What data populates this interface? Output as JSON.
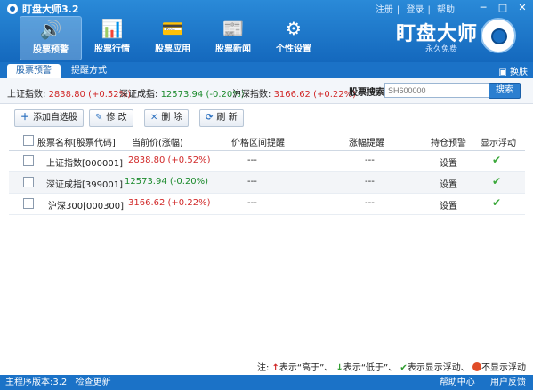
{
  "app": {
    "title": "盯盘大师3.2",
    "brand": "盯盘大师",
    "brand_sub": "永久免费"
  },
  "top_links": [
    "注册",
    "登录",
    "帮助"
  ],
  "window_controls": [
    "─",
    "□",
    "✕"
  ],
  "nav": [
    {
      "label": "股票预警",
      "icon": "🔊"
    },
    {
      "label": "股票行情",
      "icon": "📊"
    },
    {
      "label": "股票应用",
      "icon": "💳"
    },
    {
      "label": "股票新闻",
      "icon": "📰"
    },
    {
      "label": "个性设置",
      "icon": "⚙"
    }
  ],
  "tabs": {
    "tab1": "股票预警",
    "tab2": "提醒方式"
  },
  "skin": "换肤",
  "indices": [
    {
      "label": "上证指数:",
      "value": "2838.80 (+0.52%)"
    },
    {
      "label": "深证成指:",
      "value": "12573.94 (-0.20%)"
    },
    {
      "label": "沪深指数:",
      "value": "3166.62 (+0.22%)"
    }
  ],
  "search": {
    "label": "股票搜索:",
    "placeholder": "SH600000",
    "button": "搜索"
  },
  "toolbar": {
    "add": "添加自选股",
    "edit": "修 改",
    "delete": "删 除",
    "refresh": "刷 新"
  },
  "table": {
    "headers": [
      "股票名称[股票代码]",
      "当前价(涨幅)",
      "价格区间提醒",
      "涨幅提醒",
      "持仓预警",
      "显示浮动"
    ],
    "rows": [
      {
        "name": "上证指数[000001]",
        "price": "2838.80 (+0.52%)",
        "range": "---",
        "change": "---",
        "hold": "设置"
      },
      {
        "name": "深证成指[399001]",
        "price": "12573.94 (-0.20%)",
        "range": "---",
        "change": "---",
        "hold": "设置"
      },
      {
        "name": "沪深300[000300]",
        "price": "3166.62 (+0.22%)",
        "range": "---",
        "change": "---",
        "hold": "设置"
      }
    ]
  },
  "legend": {
    "prefix": "注:",
    "up": "表示“高于”、",
    "down": "表示“低于”、",
    "show": "表示显示浮动、",
    "noshow": "不显示浮动"
  },
  "status": {
    "version": "主程序版本:3.2",
    "update": "检查更新",
    "help": "帮助中心",
    "feedback": "用户反馈"
  },
  "colors": {
    "primary": "#1b72c7",
    "up": "#d12a2a",
    "down": "#1b8a2c"
  }
}
